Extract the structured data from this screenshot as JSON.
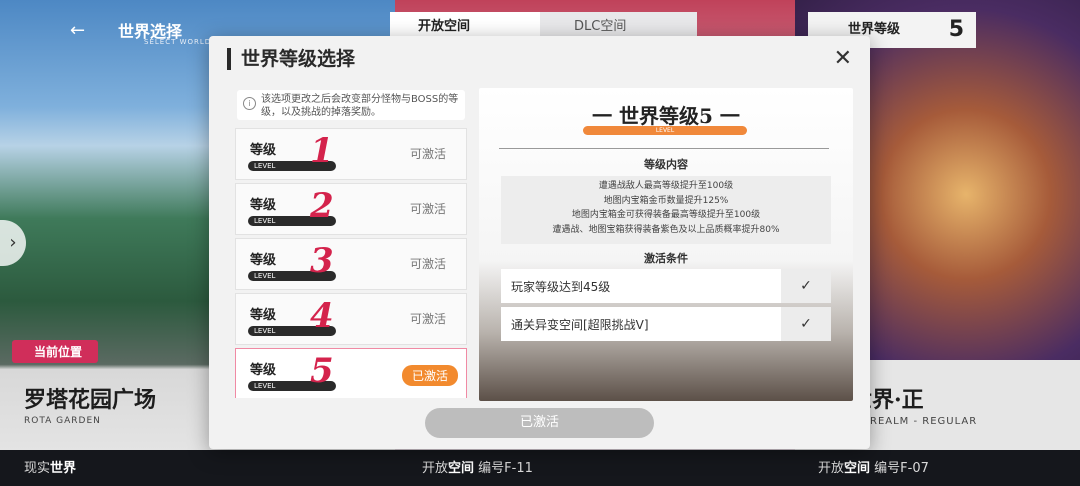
{
  "background": {
    "world_title": "世界选择",
    "world_subtitle": "SELECT WORLD",
    "tab_open": "开放空间",
    "tab_dlc": "DLC空间",
    "right_tag": "世界等级",
    "right_tag_num": "5",
    "location_pill": "当前位置",
    "left_card_name": "罗塔花园广场",
    "left_card_sub": "ROTA GARDEN",
    "right_card_name": "世界·正",
    "right_card_sub": "REALM - REGULAR",
    "bottom": [
      {
        "prefix": "现实",
        "bold": "世界",
        "suffix": ""
      },
      {
        "prefix": "开放",
        "bold": "空间",
        "suffix": " 编号F-11"
      },
      {
        "prefix": "开放",
        "bold": "空间",
        "suffix": " 编号F-07"
      }
    ]
  },
  "modal": {
    "title": "世界等级选择",
    "close": "✕",
    "notice": "该选项更改之后会改变部分怪物与BOSS的等级，以及挑战的掉落奖励。",
    "levels": [
      {
        "label": "等级",
        "pill": "LEVEL",
        "num": "1",
        "status": "可激活"
      },
      {
        "label": "等级",
        "pill": "LEVEL",
        "num": "2",
        "status": "可激活"
      },
      {
        "label": "等级",
        "pill": "LEVEL",
        "num": "3",
        "status": "可激活"
      },
      {
        "label": "等级",
        "pill": "LEVEL",
        "num": "4",
        "status": "可激活"
      },
      {
        "label": "等级",
        "pill": "LEVEL",
        "num": "5",
        "status": "已激活"
      }
    ],
    "detail": {
      "title": "一 世界等级5 一",
      "bar_label": "LEVEL",
      "content_heading": "等级内容",
      "content_lines": [
        "遭遇战敌人最高等级提升至100级",
        "地图内宝箱金币数量提升125%",
        "地图内宝箱金可获得装备最高等级提升至100级",
        "遭遇战、地图宝箱获得装备紫色及以上品质概率提升80%"
      ],
      "cond_heading": "激活条件",
      "conditions": [
        "玩家等级达到45级",
        "通关异变空间[超限挑战V]"
      ]
    },
    "activate_button": "已激活"
  }
}
